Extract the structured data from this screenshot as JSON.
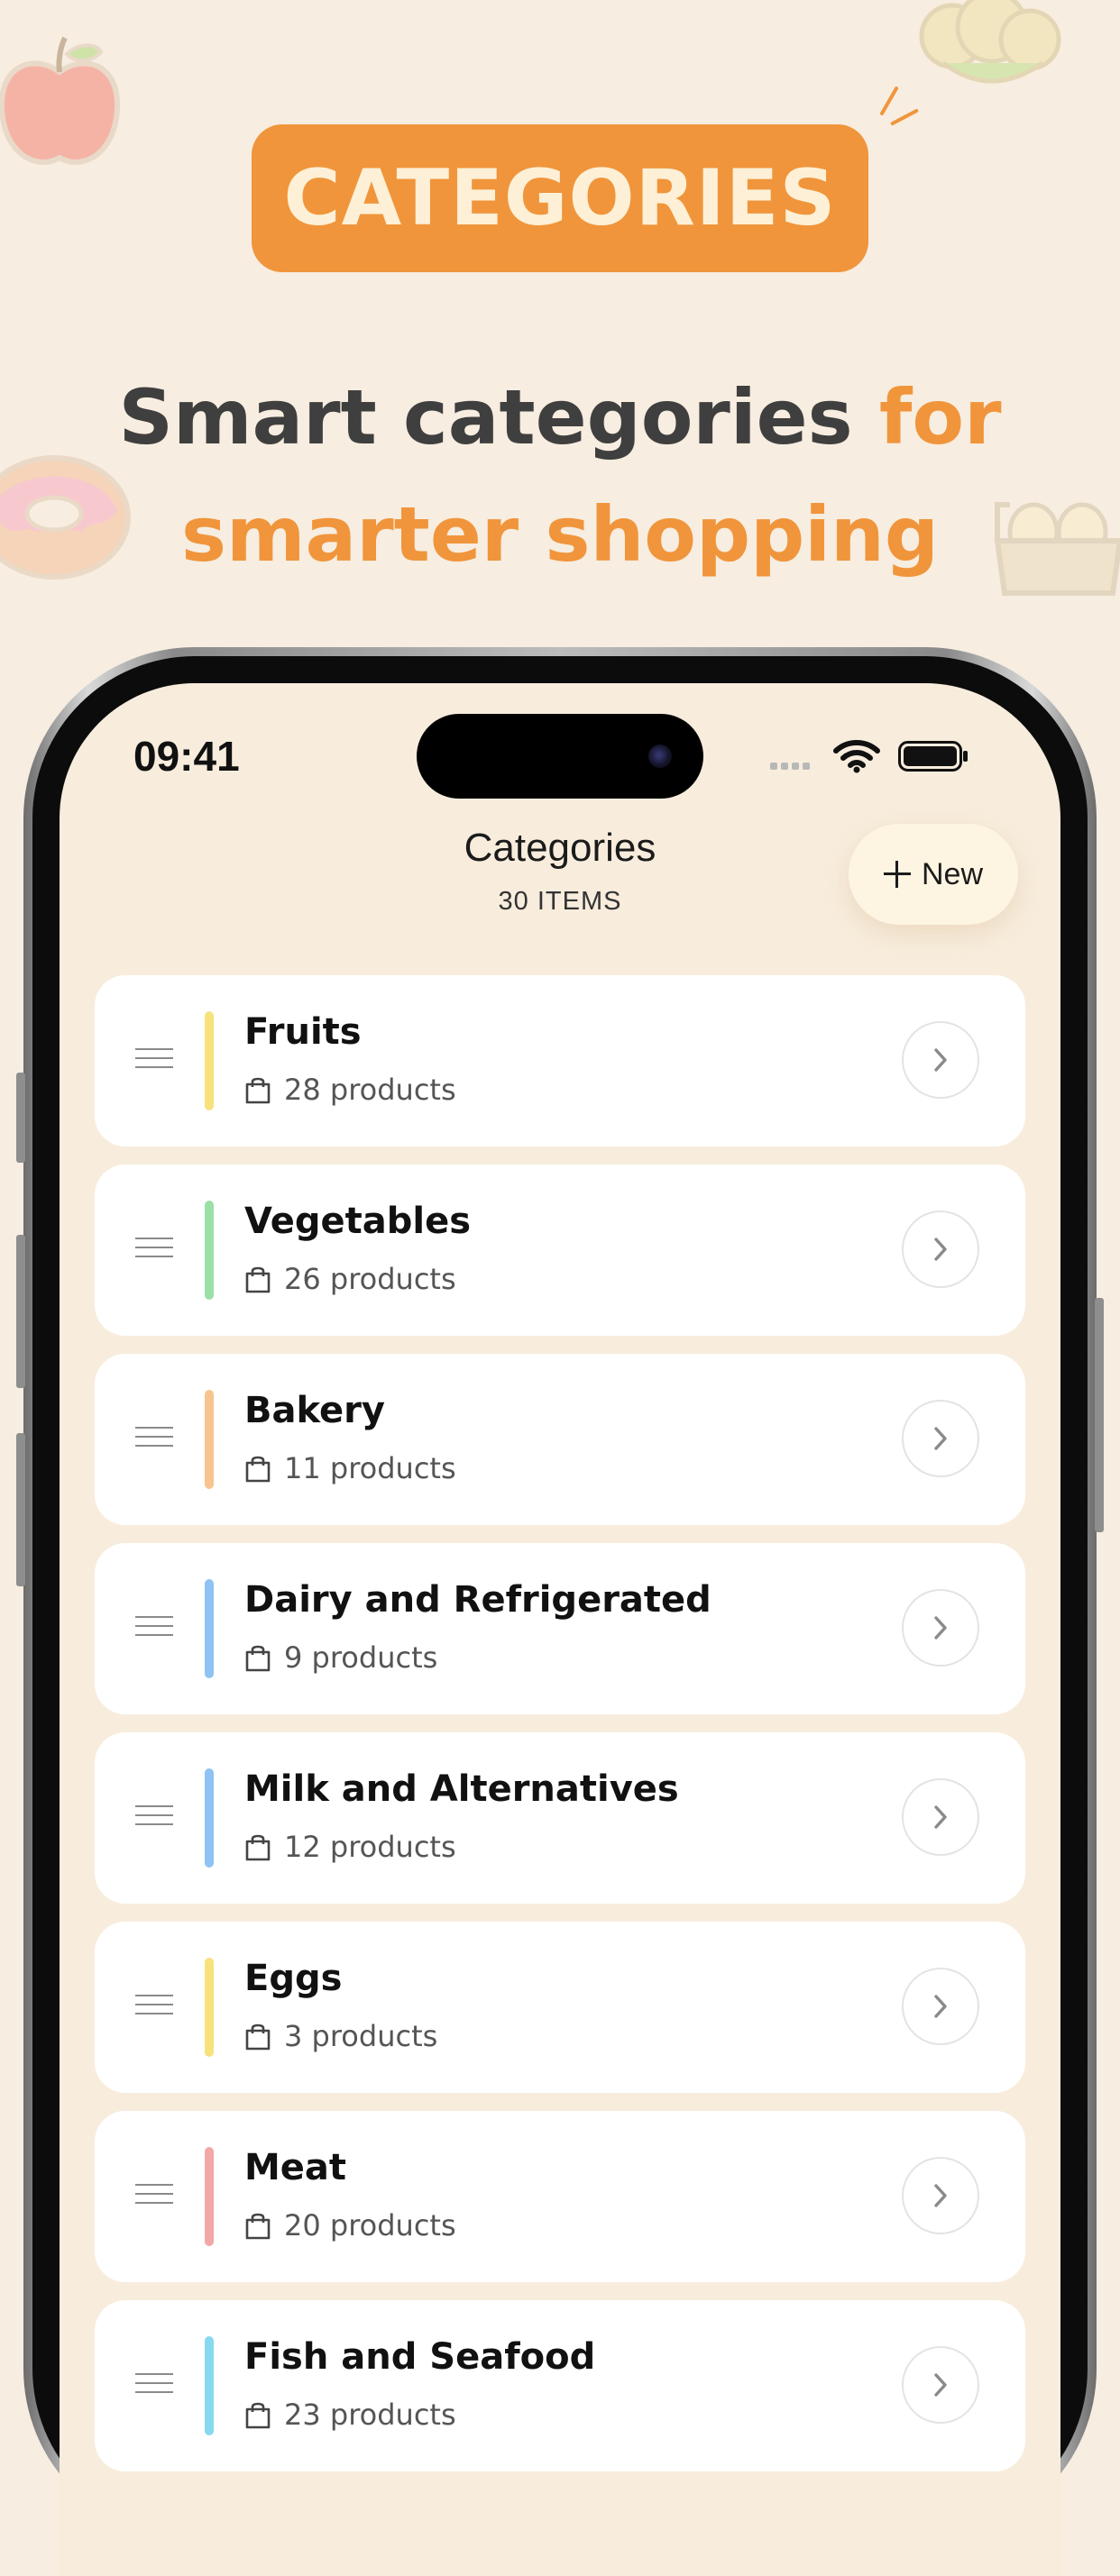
{
  "promo": {
    "badge": "CATEGORIES",
    "headline_dark": "Smart categories ",
    "headline_accent_1": "for",
    "headline_accent_2": "smarter shopping"
  },
  "status_bar": {
    "time": "09:41"
  },
  "header": {
    "title": "Categories",
    "subtitle": "30 ITEMS",
    "new_button_label": "New"
  },
  "categories": [
    {
      "name": "Fruits",
      "count": "28 products",
      "color": "#f7e27c"
    },
    {
      "name": "Vegetables",
      "count": "26 products",
      "color": "#9be0a6"
    },
    {
      "name": "Bakery",
      "count": "11 products",
      "color": "#f7c48f"
    },
    {
      "name": "Dairy and Refrigerated",
      "count": "9 products",
      "color": "#8ec3f3"
    },
    {
      "name": "Milk and Alternatives",
      "count": "12 products",
      "color": "#8ec3f3"
    },
    {
      "name": "Eggs",
      "count": "3 products",
      "color": "#f7e27c"
    },
    {
      "name": "Meat",
      "count": "20 products",
      "color": "#f4a7a7"
    },
    {
      "name": "Fish and Seafood",
      "count": "23 products",
      "color": "#87d9ef"
    }
  ],
  "colors": {
    "background": "#f7ede0",
    "accent": "#f0953b",
    "badge_text": "#fdf0d6",
    "headline_dark": "#3f3f3f",
    "card": "#ffffff"
  },
  "icons": [
    "apple-icon",
    "broccoli-icon",
    "donut-icon",
    "egg-carton-icon",
    "wifi-icon",
    "battery-icon",
    "plus-icon",
    "drag-handle-icon",
    "bag-icon",
    "chevron-right-icon"
  ]
}
